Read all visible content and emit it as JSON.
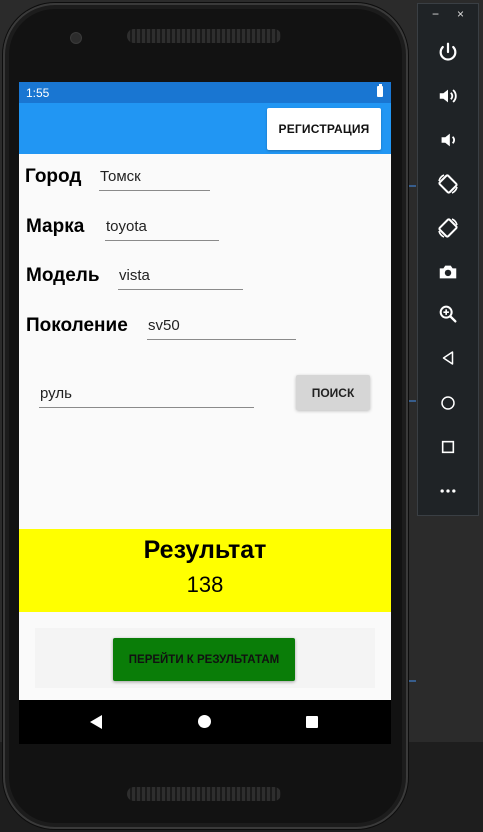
{
  "status_bar": {
    "time": "1:55"
  },
  "app_bar": {
    "register_label": "РЕГИСТРАЦИЯ"
  },
  "form": {
    "city": {
      "label": "Город",
      "value": "Томск"
    },
    "brand": {
      "label": "Марка",
      "value": "toyota"
    },
    "model": {
      "label": "Модель",
      "value": "vista"
    },
    "generation": {
      "label": "Поколение",
      "value": "sv50"
    },
    "query": {
      "value": "руль"
    },
    "search_label": "ПОИСК"
  },
  "result": {
    "title": "Результат",
    "value": "138"
  },
  "goto_results_label": "ПЕРЕЙТИ К РЕЗУЛЬТАТАМ",
  "emulator": {
    "minimize": "−",
    "close": "×",
    "buttons": [
      "power-icon",
      "volume-up-icon",
      "volume-down-icon",
      "rotate-left-icon",
      "rotate-right-icon",
      "camera-icon",
      "zoom-icon",
      "back-icon",
      "home-icon",
      "overview-icon",
      "more-icon"
    ]
  },
  "colors": {
    "status_bar": "#1976d2",
    "app_bar": "#2196f3",
    "result_panel": "#ffff00",
    "goto_button": "#0a7d08"
  }
}
